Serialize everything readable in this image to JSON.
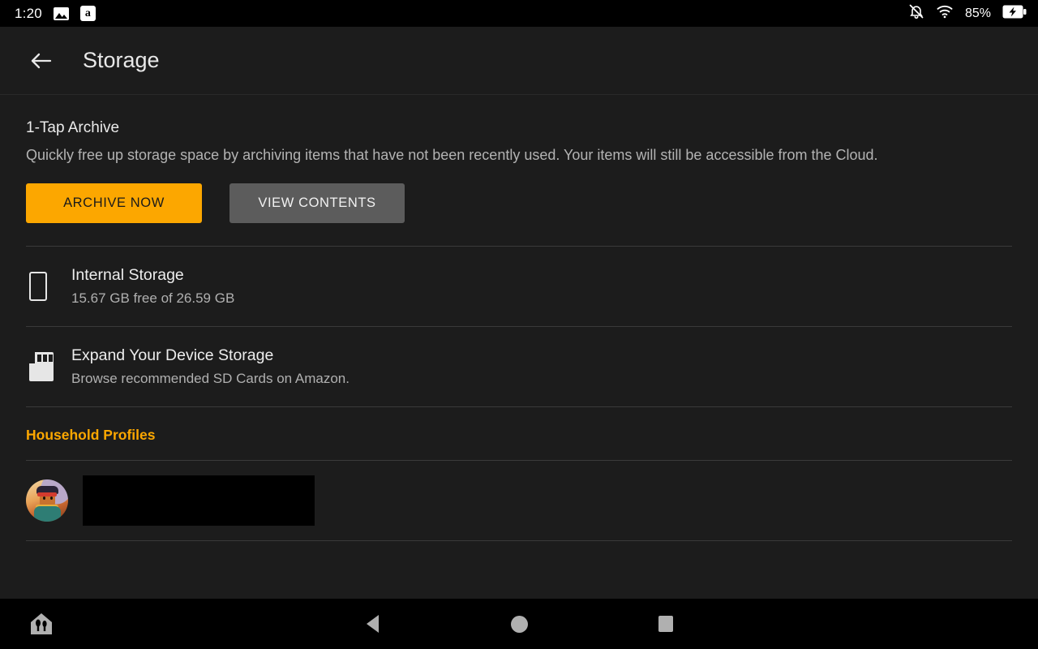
{
  "statusbar": {
    "clock": "1:20",
    "battery_percent": "85%",
    "icons": {
      "photo": "photo-icon",
      "amazon": "a",
      "notifications_off": "bell-muted-icon",
      "wifi": "wifi-icon",
      "battery": "battery-charging-icon"
    }
  },
  "header": {
    "title": "Storage",
    "back_icon": "back-arrow-icon"
  },
  "archive": {
    "title": "1-Tap Archive",
    "description": "Quickly free up storage space by archiving items that have not been recently used. Your items will still be accessible from the Cloud.",
    "archive_button": "ARCHIVE NOW",
    "view_button": "VIEW CONTENTS"
  },
  "storage_rows": [
    {
      "icon": "phone-icon",
      "title": "Internal Storage",
      "subtitle": "15.67 GB free of 26.59 GB"
    },
    {
      "icon": "sd-card-icon",
      "title": "Expand Your Device Storage",
      "subtitle": "Browse recommended SD Cards on Amazon."
    }
  ],
  "household": {
    "heading": "Household Profiles",
    "profiles": [
      {
        "avatar": "profile-avatar",
        "name": ""
      }
    ]
  },
  "navbar": {
    "home_shortcut_icon": "house-utensils-icon",
    "back_icon": "nav-back-icon",
    "home_icon": "nav-home-icon",
    "recents_icon": "nav-recents-icon"
  },
  "colors": {
    "accent": "#FCA700",
    "background": "#1c1c1c",
    "bar": "#000000",
    "secondary_button": "#5c5c5c"
  }
}
